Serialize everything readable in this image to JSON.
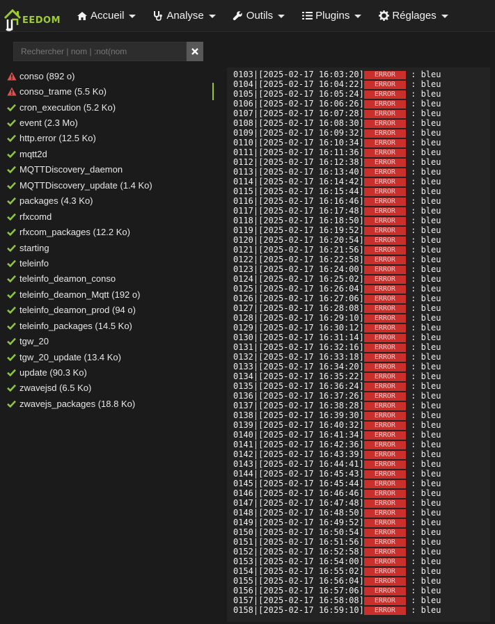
{
  "nav": {
    "brand": "EEDOM",
    "items": [
      {
        "label": "Accueil",
        "icon": "home-icon"
      },
      {
        "label": "Analyse",
        "icon": "stethoscope-icon"
      },
      {
        "label": "Outils",
        "icon": "wrench-icon"
      },
      {
        "label": "Plugins",
        "icon": "list-icon"
      },
      {
        "label": "Réglages",
        "icon": "gear-icon"
      }
    ]
  },
  "search": {
    "placeholder": "Rechercher | nom | :not(nom",
    "value": ""
  },
  "logs": [
    {
      "name": "conso (892 o)",
      "status": "warning"
    },
    {
      "name": "conso_trame (5.5 Ko)",
      "status": "warning",
      "active": true
    },
    {
      "name": "cron_execution (5.2 Ko)",
      "status": "ok"
    },
    {
      "name": "event (2.3 Mo)",
      "status": "ok"
    },
    {
      "name": "http.error (12.5 Ko)",
      "status": "ok"
    },
    {
      "name": "mqtt2d",
      "status": "ok"
    },
    {
      "name": "MQTTDiscovery_daemon",
      "status": "ok"
    },
    {
      "name": "MQTTDiscovery_update (1.4 Ko)",
      "status": "ok"
    },
    {
      "name": "packages (4.3 Ko)",
      "status": "ok"
    },
    {
      "name": "rfxcomd",
      "status": "ok"
    },
    {
      "name": "rfxcom_packages (12.2 Ko)",
      "status": "ok"
    },
    {
      "name": "starting",
      "status": "ok"
    },
    {
      "name": "teleinfo",
      "status": "ok"
    },
    {
      "name": "teleinfo_deamon_conso",
      "status": "ok"
    },
    {
      "name": "teleinfo_deamon_Mqtt (192 o)",
      "status": "ok"
    },
    {
      "name": "teleinfo_deamon_prod (94 o)",
      "status": "ok"
    },
    {
      "name": "teleinfo_packages (14.5 Ko)",
      "status": "ok"
    },
    {
      "name": "tgw_20",
      "status": "ok"
    },
    {
      "name": "tgw_20_update (13.4 Ko)",
      "status": "ok"
    },
    {
      "name": "update (90.3 Ko)",
      "status": "ok"
    },
    {
      "name": "zwavejsd (6.5 Ko)",
      "status": "ok"
    },
    {
      "name": "zwavejs_packages (18.8 Ko)",
      "status": "ok"
    }
  ],
  "log_lines": [
    {
      "num": "0103",
      "time": "2025-02-17 16:03:20",
      "level": "ERROR",
      "msg": "bleu"
    },
    {
      "num": "0104",
      "time": "2025-02-17 16:04:22",
      "level": "ERROR",
      "msg": "bleu"
    },
    {
      "num": "0105",
      "time": "2025-02-17 16:05:24",
      "level": "ERROR",
      "msg": "bleu"
    },
    {
      "num": "0106",
      "time": "2025-02-17 16:06:26",
      "level": "ERROR",
      "msg": "bleu"
    },
    {
      "num": "0107",
      "time": "2025-02-17 16:07:28",
      "level": "ERROR",
      "msg": "bleu"
    },
    {
      "num": "0108",
      "time": "2025-02-17 16:08:30",
      "level": "ERROR",
      "msg": "bleu"
    },
    {
      "num": "0109",
      "time": "2025-02-17 16:09:32",
      "level": "ERROR",
      "msg": "bleu"
    },
    {
      "num": "0110",
      "time": "2025-02-17 16:10:34",
      "level": "ERROR",
      "msg": "bleu"
    },
    {
      "num": "0111",
      "time": "2025-02-17 16:11:36",
      "level": "ERROR",
      "msg": "bleu"
    },
    {
      "num": "0112",
      "time": "2025-02-17 16:12:38",
      "level": "ERROR",
      "msg": "bleu"
    },
    {
      "num": "0113",
      "time": "2025-02-17 16:13:40",
      "level": "ERROR",
      "msg": "bleu"
    },
    {
      "num": "0114",
      "time": "2025-02-17 16:14:42",
      "level": "ERROR",
      "msg": "bleu"
    },
    {
      "num": "0115",
      "time": "2025-02-17 16:15:44",
      "level": "ERROR",
      "msg": "bleu"
    },
    {
      "num": "0116",
      "time": "2025-02-17 16:16:46",
      "level": "ERROR",
      "msg": "bleu"
    },
    {
      "num": "0117",
      "time": "2025-02-17 16:17:48",
      "level": "ERROR",
      "msg": "bleu"
    },
    {
      "num": "0118",
      "time": "2025-02-17 16:18:50",
      "level": "ERROR",
      "msg": "bleu"
    },
    {
      "num": "0119",
      "time": "2025-02-17 16:19:52",
      "level": "ERROR",
      "msg": "bleu"
    },
    {
      "num": "0120",
      "time": "2025-02-17 16:20:54",
      "level": "ERROR",
      "msg": "bleu"
    },
    {
      "num": "0121",
      "time": "2025-02-17 16:21:56",
      "level": "ERROR",
      "msg": "bleu"
    },
    {
      "num": "0122",
      "time": "2025-02-17 16:22:58",
      "level": "ERROR",
      "msg": "bleu"
    },
    {
      "num": "0123",
      "time": "2025-02-17 16:24:00",
      "level": "ERROR",
      "msg": "bleu"
    },
    {
      "num": "0124",
      "time": "2025-02-17 16:25:02",
      "level": "ERROR",
      "msg": "bleu"
    },
    {
      "num": "0125",
      "time": "2025-02-17 16:26:04",
      "level": "ERROR",
      "msg": "bleu"
    },
    {
      "num": "0126",
      "time": "2025-02-17 16:27:06",
      "level": "ERROR",
      "msg": "bleu"
    },
    {
      "num": "0127",
      "time": "2025-02-17 16:28:08",
      "level": "ERROR",
      "msg": "bleu"
    },
    {
      "num": "0128",
      "time": "2025-02-17 16:29:10",
      "level": "ERROR",
      "msg": "bleu"
    },
    {
      "num": "0129",
      "time": "2025-02-17 16:30:12",
      "level": "ERROR",
      "msg": "bleu"
    },
    {
      "num": "0130",
      "time": "2025-02-17 16:31:14",
      "level": "ERROR",
      "msg": "bleu"
    },
    {
      "num": "0131",
      "time": "2025-02-17 16:32:16",
      "level": "ERROR",
      "msg": "bleu"
    },
    {
      "num": "0132",
      "time": "2025-02-17 16:33:18",
      "level": "ERROR",
      "msg": "bleu"
    },
    {
      "num": "0133",
      "time": "2025-02-17 16:34:20",
      "level": "ERROR",
      "msg": "bleu"
    },
    {
      "num": "0134",
      "time": "2025-02-17 16:35:22",
      "level": "ERROR",
      "msg": "bleu"
    },
    {
      "num": "0135",
      "time": "2025-02-17 16:36:24",
      "level": "ERROR",
      "msg": "bleu"
    },
    {
      "num": "0136",
      "time": "2025-02-17 16:37:26",
      "level": "ERROR",
      "msg": "bleu"
    },
    {
      "num": "0137",
      "time": "2025-02-17 16:38:28",
      "level": "ERROR",
      "msg": "bleu"
    },
    {
      "num": "0138",
      "time": "2025-02-17 16:39:30",
      "level": "ERROR",
      "msg": "bleu"
    },
    {
      "num": "0139",
      "time": "2025-02-17 16:40:32",
      "level": "ERROR",
      "msg": "bleu"
    },
    {
      "num": "0140",
      "time": "2025-02-17 16:41:34",
      "level": "ERROR",
      "msg": "bleu"
    },
    {
      "num": "0141",
      "time": "2025-02-17 16:42:36",
      "level": "ERROR",
      "msg": "bleu"
    },
    {
      "num": "0142",
      "time": "2025-02-17 16:43:39",
      "level": "ERROR",
      "msg": "bleu"
    },
    {
      "num": "0143",
      "time": "2025-02-17 16:44:41",
      "level": "ERROR",
      "msg": "bleu"
    },
    {
      "num": "0144",
      "time": "2025-02-17 16:45:43",
      "level": "ERROR",
      "msg": "bleu"
    },
    {
      "num": "0145",
      "time": "2025-02-17 16:45:44",
      "level": "ERROR",
      "msg": "bleu"
    },
    {
      "num": "0146",
      "time": "2025-02-17 16:46:46",
      "level": "ERROR",
      "msg": "bleu"
    },
    {
      "num": "0147",
      "time": "2025-02-17 16:47:48",
      "level": "ERROR",
      "msg": "bleu"
    },
    {
      "num": "0148",
      "time": "2025-02-17 16:48:50",
      "level": "ERROR",
      "msg": "bleu"
    },
    {
      "num": "0149",
      "time": "2025-02-17 16:49:52",
      "level": "ERROR",
      "msg": "bleu"
    },
    {
      "num": "0150",
      "time": "2025-02-17 16:50:54",
      "level": "ERROR",
      "msg": "bleu"
    },
    {
      "num": "0151",
      "time": "2025-02-17 16:51:56",
      "level": "ERROR",
      "msg": "bleu"
    },
    {
      "num": "0152",
      "time": "2025-02-17 16:52:58",
      "level": "ERROR",
      "msg": "bleu"
    },
    {
      "num": "0153",
      "time": "2025-02-17 16:54:00",
      "level": "ERROR",
      "msg": "bleu"
    },
    {
      "num": "0154",
      "time": "2025-02-17 16:55:02",
      "level": "ERROR",
      "msg": "bleu"
    },
    {
      "num": "0155",
      "time": "2025-02-17 16:56:04",
      "level": "ERROR",
      "msg": "bleu"
    },
    {
      "num": "0156",
      "time": "2025-02-17 16:57:06",
      "level": "ERROR",
      "msg": "bleu"
    },
    {
      "num": "0157",
      "time": "2025-02-17 16:58:08",
      "level": "ERROR",
      "msg": "bleu"
    },
    {
      "num": "0158",
      "time": "2025-02-17 16:59:10",
      "level": "ERROR",
      "msg": "bleu"
    }
  ],
  "colors": {
    "brand": "#9dcc2f",
    "ok": "#8ec63f",
    "warning": "#d9534f",
    "error_badge": "#c9302c"
  }
}
